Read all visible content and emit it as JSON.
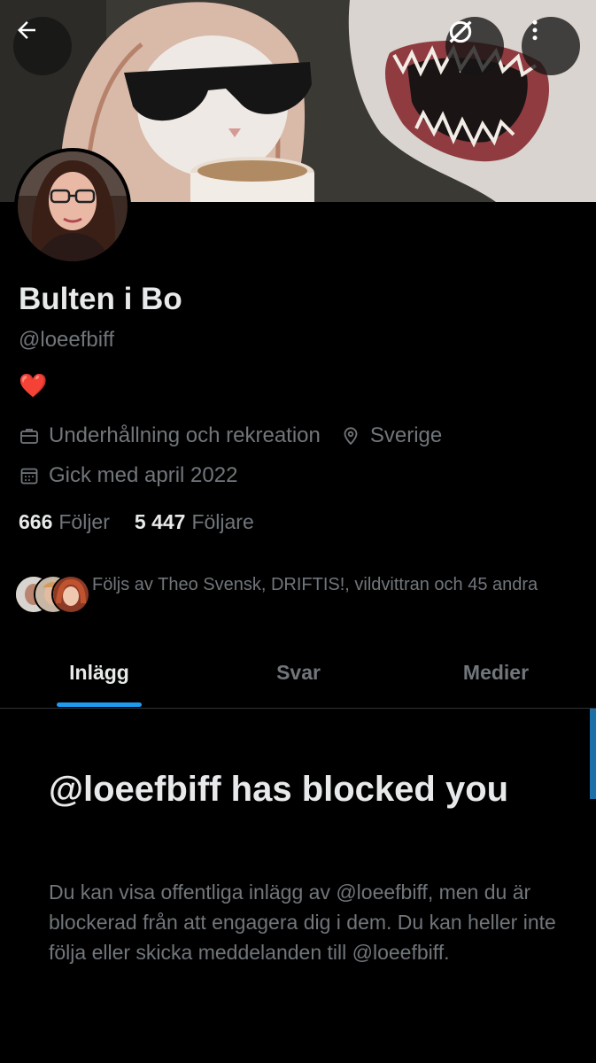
{
  "header": {
    "back_icon": "arrow-left-icon",
    "grok_icon": "grok-slash-icon",
    "more_icon": "more-vertical-icon"
  },
  "profile": {
    "display_name": "Bulten i Bo",
    "handle": "@loeefbiff",
    "bio": "❤️",
    "category": "Underhållning och rekreation",
    "location": "Sverige",
    "joined": "Gick med april 2022",
    "following_count": "666",
    "following_label": "Följer",
    "followers_count": "5 447",
    "followers_label": "Följare",
    "followed_by": "Följs av Theo Svensk, DRIFTIS!, vildvittran och 45 andra"
  },
  "tabs": [
    {
      "label": "Inlägg",
      "active": true
    },
    {
      "label": "Svar",
      "active": false
    },
    {
      "label": "Medier",
      "active": false
    }
  ],
  "blocked": {
    "title": "@loeefbiff has blocked you",
    "body": "Du kan visa offentliga inlägg av @loeefbiff, men du är blockerad från att engagera dig i dem. Du kan heller inte följa eller skicka meddelanden till @loeefbiff."
  },
  "colors": {
    "background": "#000000",
    "text_primary": "#e7e9ea",
    "text_secondary": "#71767b",
    "accent": "#1d9bf0",
    "heart": "#f91880"
  }
}
